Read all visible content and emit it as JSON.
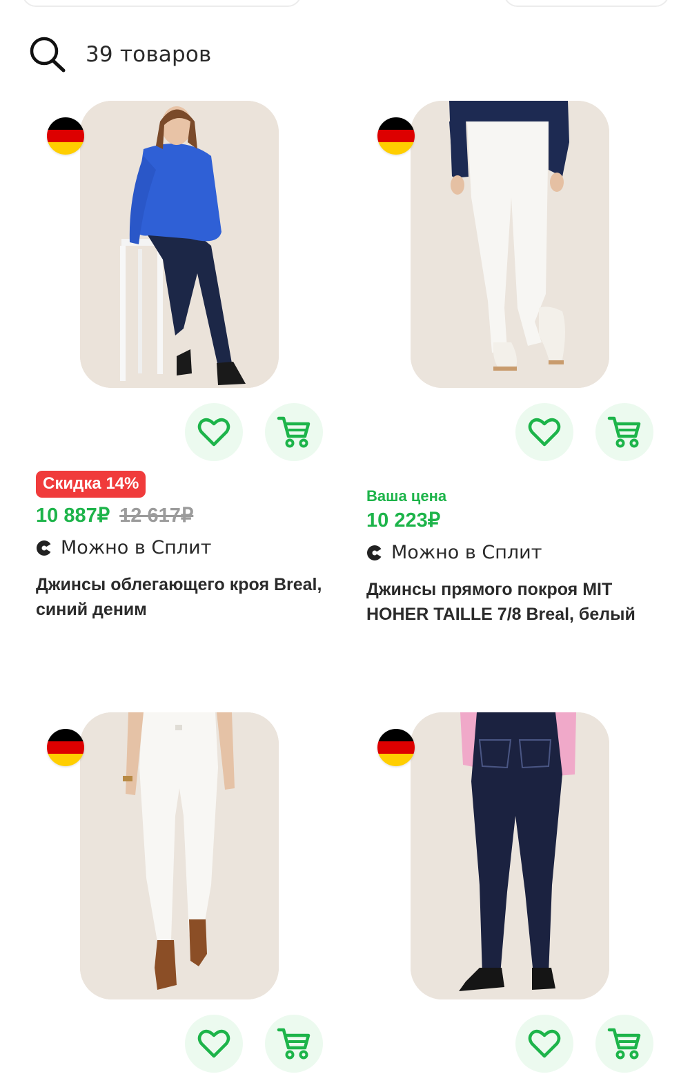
{
  "results": {
    "count_label": "39 товаров"
  },
  "products": [
    {
      "has_sale": true,
      "sale_badge": "Скидка 14%",
      "your_price_label": "",
      "price": "10 887₽",
      "old_price": "12 617₽",
      "split_label": "Можно в Сплит",
      "title": "Джинсы облегающего кроя Breal, синий деним"
    },
    {
      "has_sale": false,
      "sale_badge": "",
      "your_price_label": "Ваша цена",
      "price": "10 223₽",
      "old_price": "",
      "split_label": "Можно в Сплит",
      "title": "Джинсы прямого покроя MIT HOHER TAILLE 7/8 Breal, белый"
    },
    {
      "has_sale": false
    },
    {
      "has_sale": false
    }
  ],
  "flag_colors": [
    "#000000",
    "#dd0000",
    "#ffce00"
  ],
  "colors": {
    "accent_green": "#1db44a",
    "sale_red": "#f03b3b",
    "button_bg": "#ecfaef",
    "old_price": "#9b9b9b"
  },
  "icons": {
    "search": "search-icon",
    "favorite": "heart-icon",
    "cart": "cart-icon",
    "split": "split-icon",
    "flag": "germany-flag-icon"
  }
}
